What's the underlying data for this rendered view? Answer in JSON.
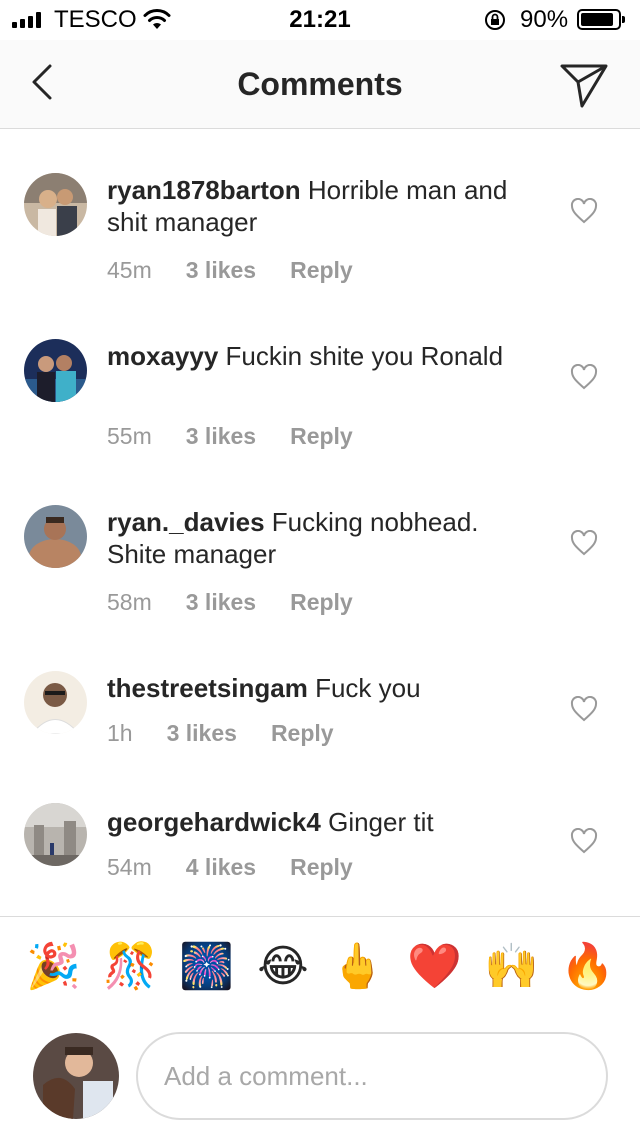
{
  "status_bar": {
    "carrier": "TESCO",
    "time": "21:21",
    "battery_percent": "90%",
    "battery_level": 0.9,
    "icons": [
      "signal-icon",
      "wifi-icon",
      "orientation-lock-icon",
      "battery-icon"
    ]
  },
  "header": {
    "title": "Comments",
    "back_icon": "chevron-left-icon",
    "send_icon": "paper-plane-icon"
  },
  "comments": [
    {
      "username": "ryan1878barton",
      "text": "Horrible man and shit manager",
      "time": "45m",
      "likes": "3 likes",
      "reply": "Reply"
    },
    {
      "username": "moxayyy",
      "text": "Fuckin shite you Ronald",
      "time": "55m",
      "likes": "3 likes",
      "reply": "Reply"
    },
    {
      "username": "ryan._davies",
      "text": "Fucking nobhead. Shite manager",
      "time": "58m",
      "likes": "3 likes",
      "reply": "Reply"
    },
    {
      "username": "thestreetsingam",
      "text": "Fuck you",
      "time": "1h",
      "likes": "3 likes",
      "reply": "Reply"
    },
    {
      "username": "georgehardwick4",
      "text": "Ginger tit",
      "time": "54m",
      "likes": "4 likes",
      "reply": "Reply"
    }
  ],
  "emoji_bar": {
    "emojis": [
      "🎉",
      "🎊",
      "🎆",
      "😂",
      "🖕",
      "❤️",
      "🙌",
      "🔥"
    ]
  },
  "composer": {
    "placeholder": "Add a comment..."
  },
  "colors": {
    "text": "#262626",
    "meta": "#999999",
    "divider": "#dbdbdb",
    "header_bg": "#fafafa"
  }
}
